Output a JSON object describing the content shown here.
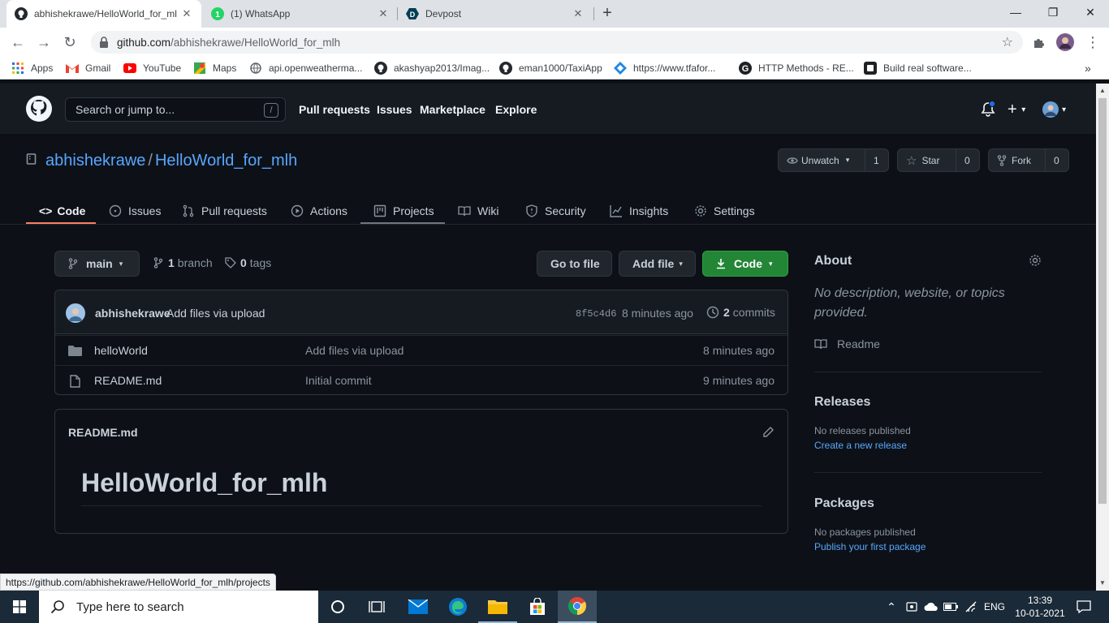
{
  "browser": {
    "tabs": [
      {
        "title": "abhishekrawe/HelloWorld_for_ml",
        "active": true
      },
      {
        "title": "(1) WhatsApp",
        "badge": "1"
      },
      {
        "title": "Devpost"
      }
    ],
    "url_host": "github.com",
    "url_path": "/abhishekrawe/HelloWorld_for_mlh",
    "bookmarks": [
      "Apps",
      "Gmail",
      "YouTube",
      "Maps",
      "api.openweatherma...",
      "akashyap2013/Imag...",
      "eman1000/TaxiApp",
      "https://www.tfafor...",
      "HTTP Methods - RE...",
      "Build real software..."
    ]
  },
  "github": {
    "search_placeholder": "Search or jump to...",
    "search_key": "/",
    "nav": [
      "Pull requests",
      "Issues",
      "Marketplace",
      "Explore"
    ],
    "owner": "abhishekrawe",
    "repo": "HelloWorld_for_mlh",
    "watch": {
      "label": "Unwatch",
      "count": "1"
    },
    "star": {
      "label": "Star",
      "count": "0"
    },
    "fork": {
      "label": "Fork",
      "count": "0"
    },
    "repo_tabs": [
      "Code",
      "Issues",
      "Pull requests",
      "Actions",
      "Projects",
      "Wiki",
      "Security",
      "Insights",
      "Settings"
    ],
    "branch": "main",
    "branch_count": "1",
    "branch_label": "branch",
    "tag_count": "0",
    "tag_label": "tags",
    "goto_file": "Go to file",
    "add_file": "Add file",
    "code_button": "Code",
    "commit": {
      "author": "abhishekrawe",
      "message": "Add files via upload",
      "sha": "8f5c4d6",
      "time": "8 minutes ago",
      "count": "2",
      "count_label": "commits"
    },
    "files": [
      {
        "name": "helloWorld",
        "type": "folder",
        "message": "Add files via upload",
        "time": "8 minutes ago"
      },
      {
        "name": "README.md",
        "type": "file",
        "message": "Initial commit",
        "time": "9 minutes ago"
      }
    ],
    "readme": {
      "filename": "README.md",
      "heading": "HelloWorld_for_mlh"
    },
    "about": {
      "title": "About",
      "description": "No description, website, or topics provided.",
      "readme_link": "Readme"
    },
    "releases": {
      "title": "Releases",
      "empty": "No releases published",
      "link": "Create a new release"
    },
    "packages": {
      "title": "Packages",
      "empty": "No packages published",
      "link": "Publish your first package"
    },
    "status_url": "https://github.com/abhishekrawe/HelloWorld_for_mlh/projects"
  },
  "taskbar": {
    "search_placeholder": "Type here to search",
    "language": "ENG",
    "time": "13:39",
    "date": "10-01-2021"
  },
  "colors": {
    "bg": "#0d1117",
    "header": "#161b22",
    "link": "#58a6ff",
    "green": "#238636",
    "tab_underline": "#f78166"
  }
}
